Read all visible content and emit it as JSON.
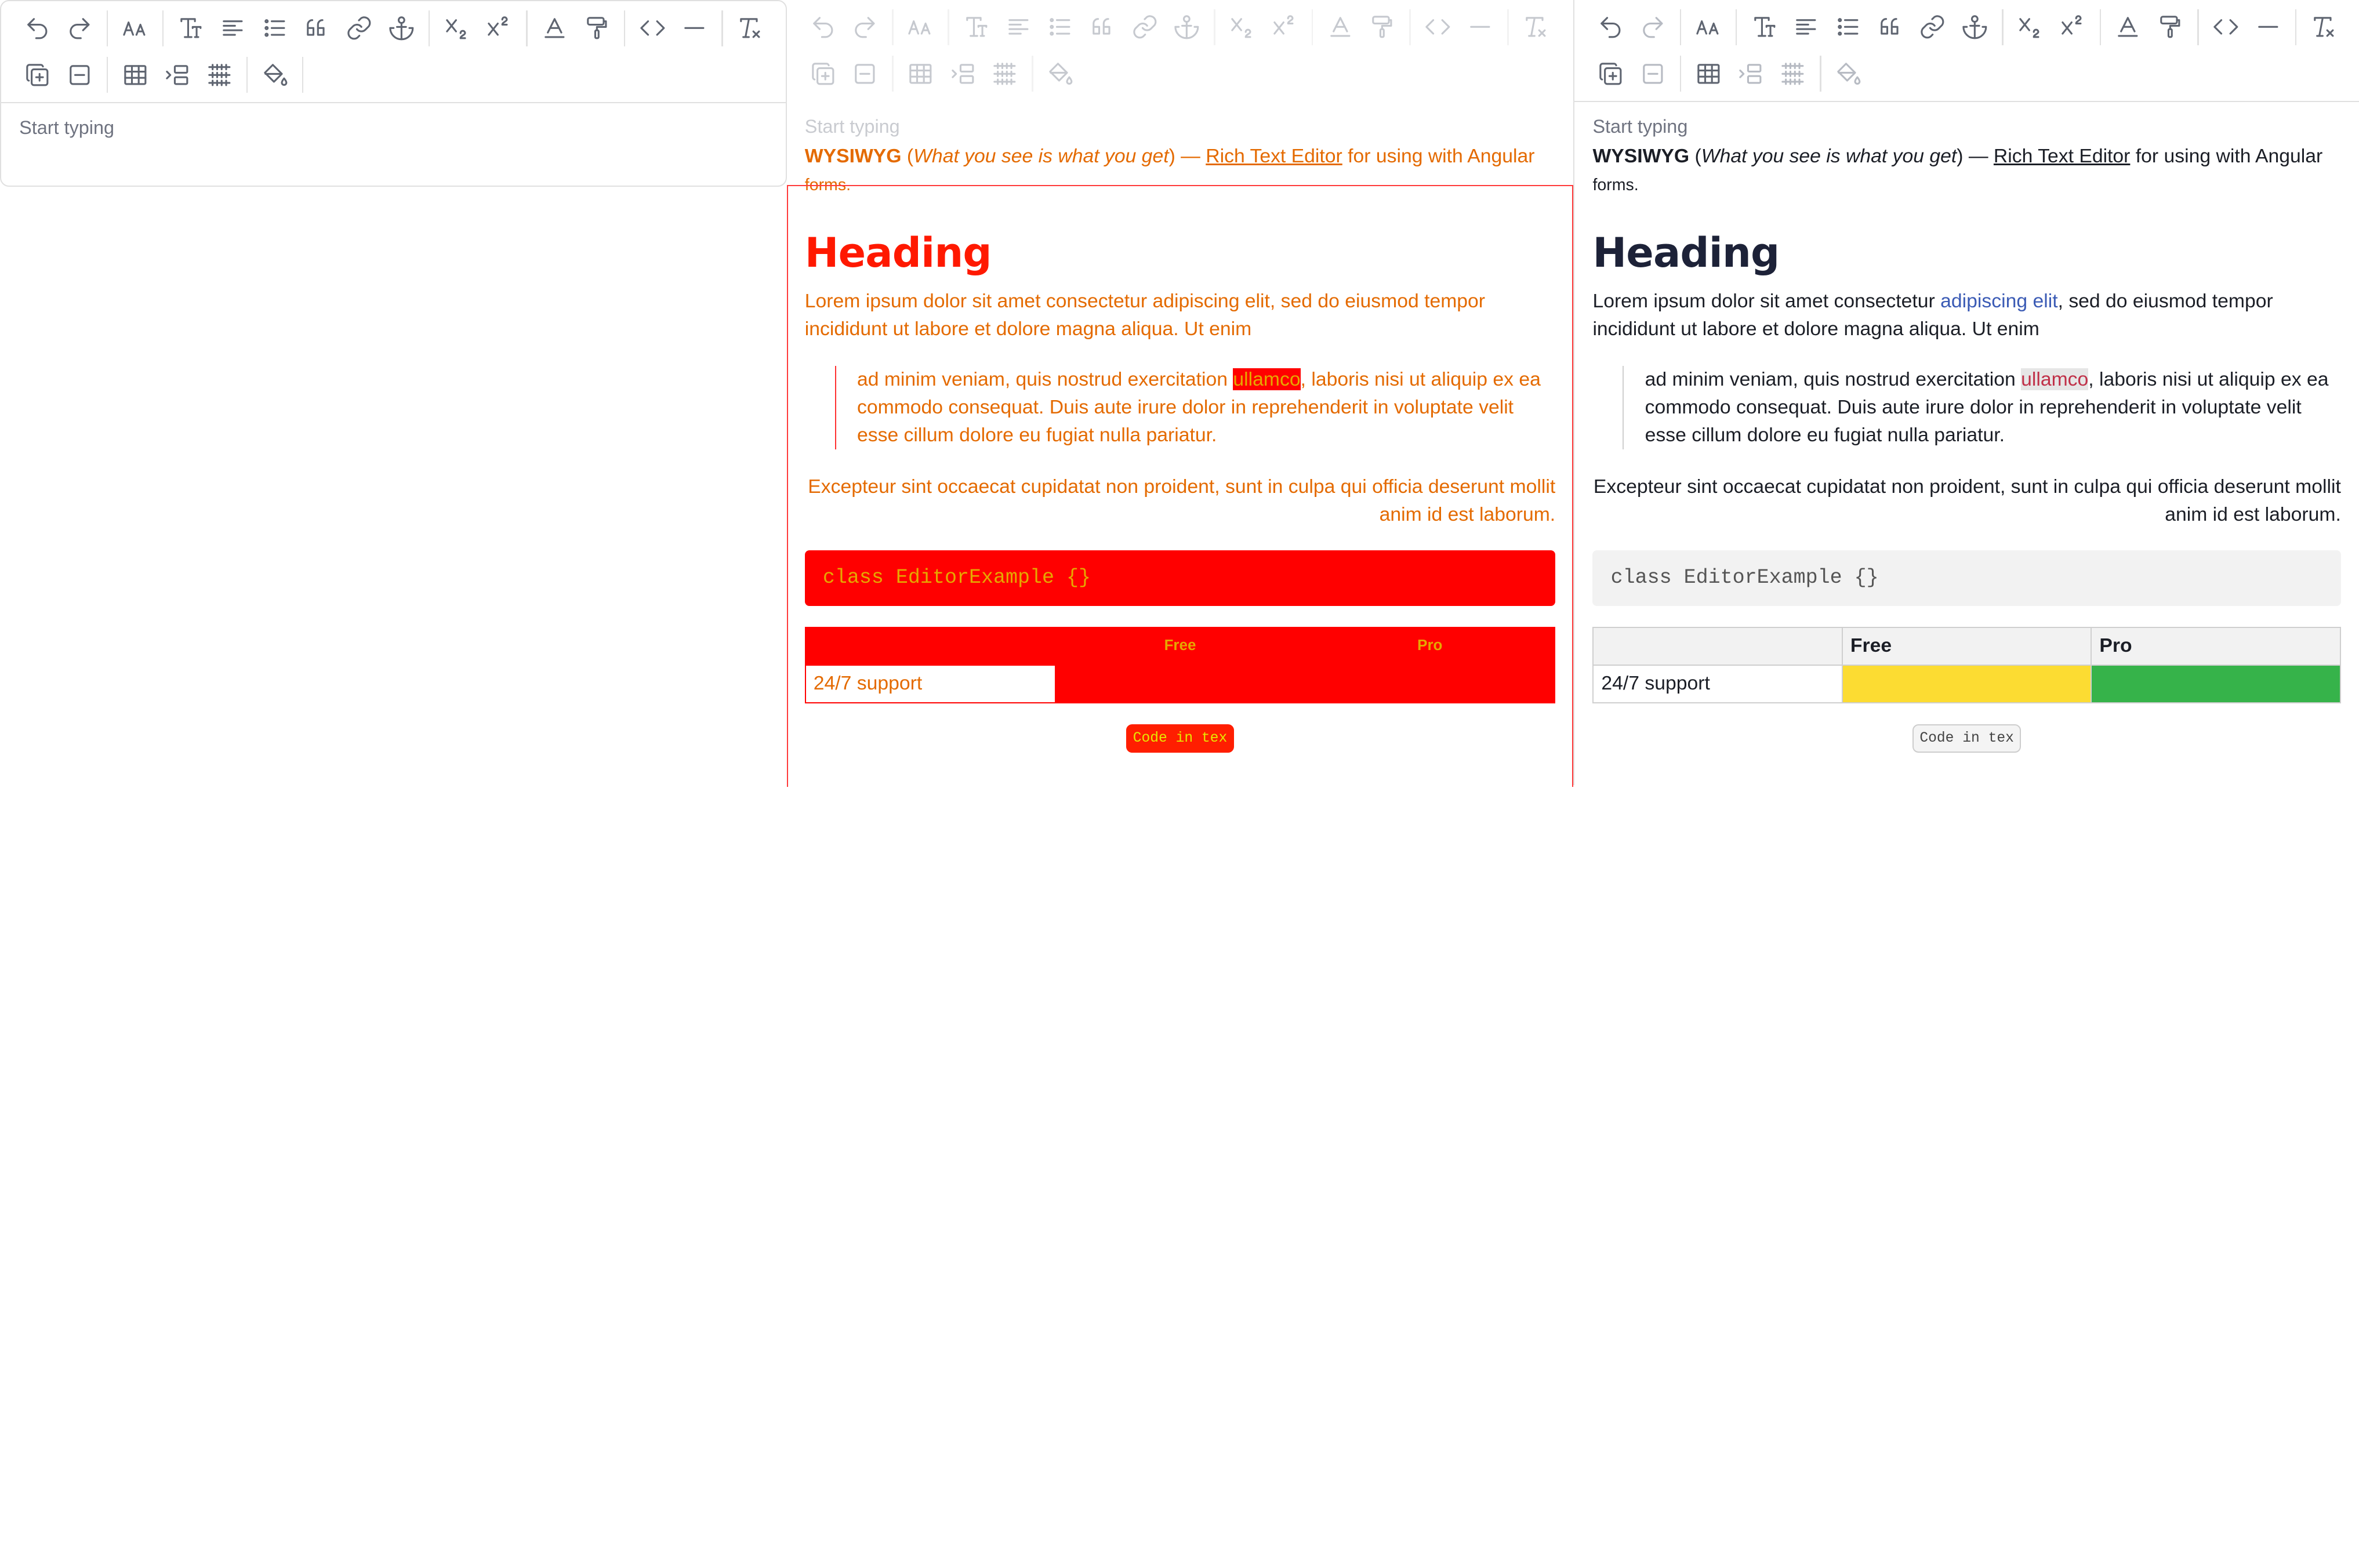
{
  "toolbar": {
    "row1": [
      "undo-icon",
      "redo-icon",
      "sep",
      "font-size-icon",
      "sep",
      "text-style-icon",
      "align-icon",
      "list-icon",
      "blockquote-icon",
      "link-icon",
      "anchor-icon",
      "sep",
      "subscript-icon",
      "superscript-icon",
      "sep",
      "text-color-icon",
      "format-painter-icon",
      "sep",
      "code-icon",
      "horizontal-rule-icon",
      "sep",
      "clear-format-icon"
    ],
    "row2": [
      "add-block-icon",
      "remove-block-icon",
      "sep",
      "table-icon",
      "insert-column-icon",
      "table-grid-icon",
      "sep",
      "paint-bucket-icon"
    ]
  },
  "editor": {
    "placeholder": "Start typing",
    "lead_bold": "WYSIWYG",
    "lead_paren_open": " (",
    "lead_italic": "What you see is what you get",
    "lead_mid": ") — ",
    "lead_link": "Rich Text Editor",
    "lead_tail": " for using with Angular ",
    "lead_small": "forms.",
    "heading": "Heading",
    "p1_a": "Lorem ipsum dolor sit amet consectetur ",
    "p1_link": "adipiscing elit",
    "p1_b": ", sed do eiusmod tempor incididunt ut labore et dolore magna aliqua. Ut enim",
    "quote_a": "ad minim veniam, quis nostrud exercitation ",
    "quote_mark": "ullamco",
    "quote_b": ", laboris nisi ut aliquip ex ea commodo consequat. Duis aute irure dolor in reprehenderit in voluptate velit esse cillum dolore eu fugiat nulla pariatur.",
    "right_para": "Excepteur sint occaecat cupidatat non proident, sunt in culpa qui officia deserunt mollit anim id est laborum.",
    "code": "class EditorExample {}",
    "table": {
      "headers": [
        "",
        "Free",
        "Pro"
      ],
      "row": [
        "24/7 support",
        "",
        ""
      ]
    },
    "code_pill": "Code in tex"
  },
  "colors": {
    "accent_link": "#3b5bb5",
    "error_red": "#ff0000",
    "error_text": "#e46a00",
    "cell_yellow": "#fcdc32",
    "cell_green": "#36b34a"
  }
}
